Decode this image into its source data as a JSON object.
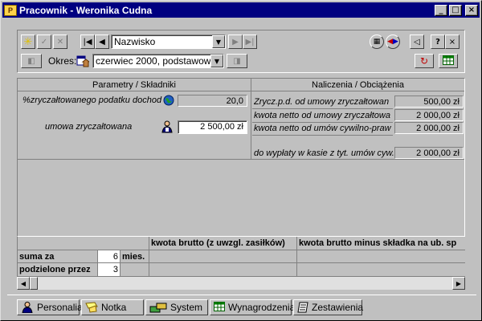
{
  "window": {
    "title": "Pracownik - Weronika Cudna",
    "icon": "app-icon",
    "minimize": "_",
    "maximize": "□",
    "close": "×"
  },
  "toolbar": {
    "new_icon": "star-icon",
    "ok_icon": "checkmark-icon",
    "cancel_icon": "x-icon",
    "first_icon": "first-record-icon",
    "prev_icon": "prev-record-icon",
    "next_icon": "next-record-icon",
    "last_icon": "last-record-icon",
    "sort_field": "Nazwisko",
    "period_label": "Okres:",
    "period_value": "czerwiec 2000, podstawowy",
    "help_label": "?",
    "close_label": "×",
    "back_label": "◁"
  },
  "panel": {
    "left_header": "Parametry / Składniki",
    "right_header": "Naliczenia / Obciążenia",
    "left_rows": [
      {
        "label": "%zryczałtowanego podatku dochod",
        "value": "20,0"
      },
      {
        "label": "umowa zryczałtowana",
        "value": "2 500,00 zł"
      }
    ],
    "right_rows": [
      {
        "label": "Zrycz.p.d. od umowy zryczałtowan",
        "value": "500,00 zł"
      },
      {
        "label": "kwota netto od umowy zryczałtowa",
        "value": "2 000,00 zł"
      },
      {
        "label": "kwota netto od umów cywilno-praw",
        "value": "2 000,00 zł"
      },
      {
        "label": "do wypłaty w kasie z tyt. umów cyw.",
        "value": "2 000,00 zł"
      }
    ]
  },
  "grid": {
    "col1_header": "kwota brutto (z uwzgl. zasiłków)",
    "col2_header": "kwota brutto minus składka na ub. sp",
    "rows": [
      {
        "label": "suma za",
        "value": "6",
        "unit": "mies."
      },
      {
        "label": "podzielone przez",
        "value": "3",
        "unit": ""
      }
    ]
  },
  "tabs": [
    {
      "label": "Personalia",
      "icon": "person-icon"
    },
    {
      "label": "Notka",
      "icon": "note-icon"
    },
    {
      "label": "System",
      "icon": "system-icon"
    },
    {
      "label": "Wynagrodzenia",
      "icon": "payroll-icon"
    },
    {
      "label": "Zestawienia",
      "icon": "report-icon"
    }
  ]
}
